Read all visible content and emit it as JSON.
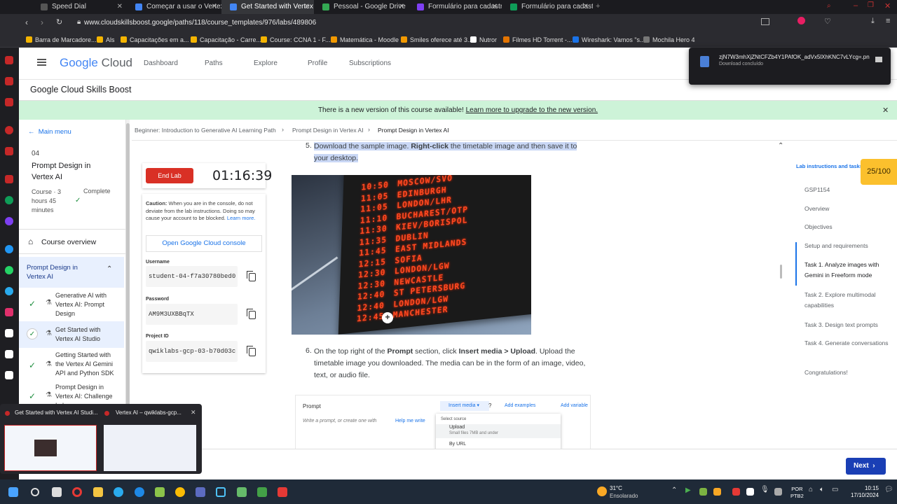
{
  "browser": {
    "tabs": [
      {
        "label": "Speed Dial",
        "color": "#555"
      },
      {
        "label": "Começar a usar o Vertex AI",
        "color": "#4285f4"
      },
      {
        "label": "Get Started with Vertex AI S",
        "color": "#4285f4"
      },
      {
        "label": "Pessoal - Google Drive",
        "color": "#34a853"
      },
      {
        "label": "Formulário para cadastro",
        "color": "#7e3ff2"
      },
      {
        "label": "Formulário para cadastro",
        "color": "#0f9d58"
      }
    ],
    "url": "www.cloudskillsboost.google/paths/118/course_templates/976/labs/489806",
    "bookmarks": [
      {
        "label": "Barra de Marcadore...",
        "color": "#f4b400"
      },
      {
        "label": "Als",
        "color": "#f4b400"
      },
      {
        "label": "Capacitações em a...",
        "color": "#f4b400"
      },
      {
        "label": "Capacitação - Carre...",
        "color": "#f4b400"
      },
      {
        "label": "Course: CCNA 1 - F...",
        "color": "#f4b400"
      },
      {
        "label": "Matemática - Moodle",
        "color": "#f29900"
      },
      {
        "label": "Smiles oferece até 3...",
        "color": "#f29900"
      },
      {
        "label": "Nutror",
        "color": "#ffffff"
      },
      {
        "label": "Filmes HD Torrent -...",
        "color": "#e37400"
      },
      {
        "label": "Wireshark: Vamos \"s...",
        "color": "#1a73e8"
      },
      {
        "label": "Mochila Hero 4",
        "color": "#777"
      }
    ],
    "download": {
      "filename": "zjN7W3mhXjZNtCFZb4Y1PAfOK_adVx5lXhKNC7vLYcg=.png",
      "status": "Download concluído"
    }
  },
  "header": {
    "logo_google": "Google",
    "logo_cloud": "Cloud",
    "nav": [
      "Dashboard",
      "Paths",
      "Explore",
      "Profile",
      "Subscriptions"
    ],
    "subtitle": "Google Cloud Skills Boost"
  },
  "banner": {
    "text": "There is a new version of this course available! ",
    "link": "Learn more to upgrade to the new version."
  },
  "breadcrumb": [
    "Beginner: Introduction to Generative AI Learning Path",
    "Prompt Design in Vertex AI",
    "Prompt Design in Vertex AI"
  ],
  "sidebar": {
    "main_menu": "Main menu",
    "number": "04",
    "title": "Prompt Design in Vertex AI",
    "meta": "Course · 3 hours 45 minutes",
    "status": "Complete",
    "overview": "Course overview",
    "section": "Prompt Design in Vertex AI",
    "items": [
      {
        "label": "Generative AI with Vertex AI: Prompt Design"
      },
      {
        "label": "Get Started with Vertex AI Studio"
      },
      {
        "label": "Getting Started with the Vertex AI Gemini API and Python SDK"
      },
      {
        "label": "Prompt Design in Vertex AI: Challenge Lab"
      }
    ]
  },
  "lab": {
    "end_label": "End Lab",
    "timer": "01:16:39",
    "caution_bold": "Caution:",
    "caution_text": " When you are in the console, do not deviate from the lab instructions. Doing so may cause your account to be blocked.",
    "learn_more": "Learn more.",
    "open_console": "Open Google Cloud console",
    "username_label": "Username",
    "username": "student-04-f7a30780bed0",
    "password_label": "Password",
    "password": "AM9M3UXBBqTX",
    "project_label": "Project ID",
    "project": "qwiklabs-gcp-03-b70d03c"
  },
  "content": {
    "step5_num": "5.",
    "step5_a": "Download the sample image. ",
    "step5_b": "Right-click",
    "step5_c": " the timetable image and then save it to your desktop.",
    "board": [
      [
        "10:50",
        "MOSCOW/SVO"
      ],
      [
        "11:05",
        "EDINBURGH"
      ],
      [
        "11:05",
        "LONDON/LHR"
      ],
      [
        "11:10",
        "BUCHAREST/OTP"
      ],
      [
        "11:30",
        "KIEV/BORISPOL"
      ],
      [
        "11:35",
        "DUBLIN"
      ],
      [
        "11:45",
        "EAST MIDLANDS"
      ],
      [
        "12:15",
        "SOFIA"
      ],
      [
        "12:30",
        "LONDON/LGW"
      ],
      [
        "12:30",
        "NEWCASTLE"
      ],
      [
        "12:40",
        "ST PETERSBURG"
      ],
      [
        "12:40",
        "LONDON/LGW"
      ],
      [
        "12:45",
        "MANCHESTER"
      ]
    ],
    "step6_num": "6.",
    "step6_a": "On the top right of the ",
    "step6_b": "Prompt",
    "step6_c": " section, click ",
    "step6_d": "Insert media > Upload",
    "step6_e": ". Upload the timetable image you downloaded. The media can be in the form of an image, video, text, or audio file.",
    "shot": {
      "title": "Prompt",
      "insert": "Insert media",
      "add_examples": "Add examples",
      "add_variable": "Add variable",
      "placeholder": "Write a prompt, or create one with",
      "help": "Help me write",
      "select_source": "Select source",
      "upload": "Upload",
      "upload_sub": "Small files 7MB and under",
      "byurl": "By URL"
    }
  },
  "toc": {
    "title": "Lab instructions and tasks",
    "score": "25/100",
    "items": [
      "GSP1154",
      "Overview",
      "Objectives",
      "Setup and requirements",
      "Task 1. Analyze images with Gemini in Freeform mode",
      "Task 2. Explore multimodal capabilities",
      "Task 3. Design text prompts",
      "Task 4. Generate conversations",
      "Congratulations!"
    ]
  },
  "next_label": "Next",
  "previews": [
    {
      "label": "Get Started with Vertex AI Studi..."
    },
    {
      "label": "Vertex AI – qwiklabs-gcp..."
    }
  ],
  "taskbar": {
    "temp": "31°C",
    "weather": "Ensolarado",
    "lang1": "POR",
    "lang2": "PTB2",
    "time": "10:15",
    "date": "17/10/2024"
  }
}
